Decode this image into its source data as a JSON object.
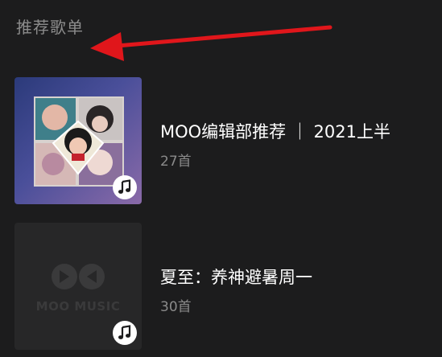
{
  "section": {
    "title": "推荐歌单"
  },
  "playlists": [
    {
      "title": "MOO编辑部推荐 ｜ 2021上半",
      "count": "27首",
      "cover": "collage"
    },
    {
      "title": "夏至：养神避暑周一",
      "count": "30首",
      "cover": "placeholder",
      "cover_brand": "MOO MUSIC"
    }
  ],
  "icons": {
    "music_badge": "music-note-icon",
    "annotation": "red-arrow-icon"
  },
  "colors": {
    "background": "#1c1c1d",
    "title_text": "#ffffff",
    "muted_text": "#8a8a8a",
    "arrow": "#e0161b"
  }
}
